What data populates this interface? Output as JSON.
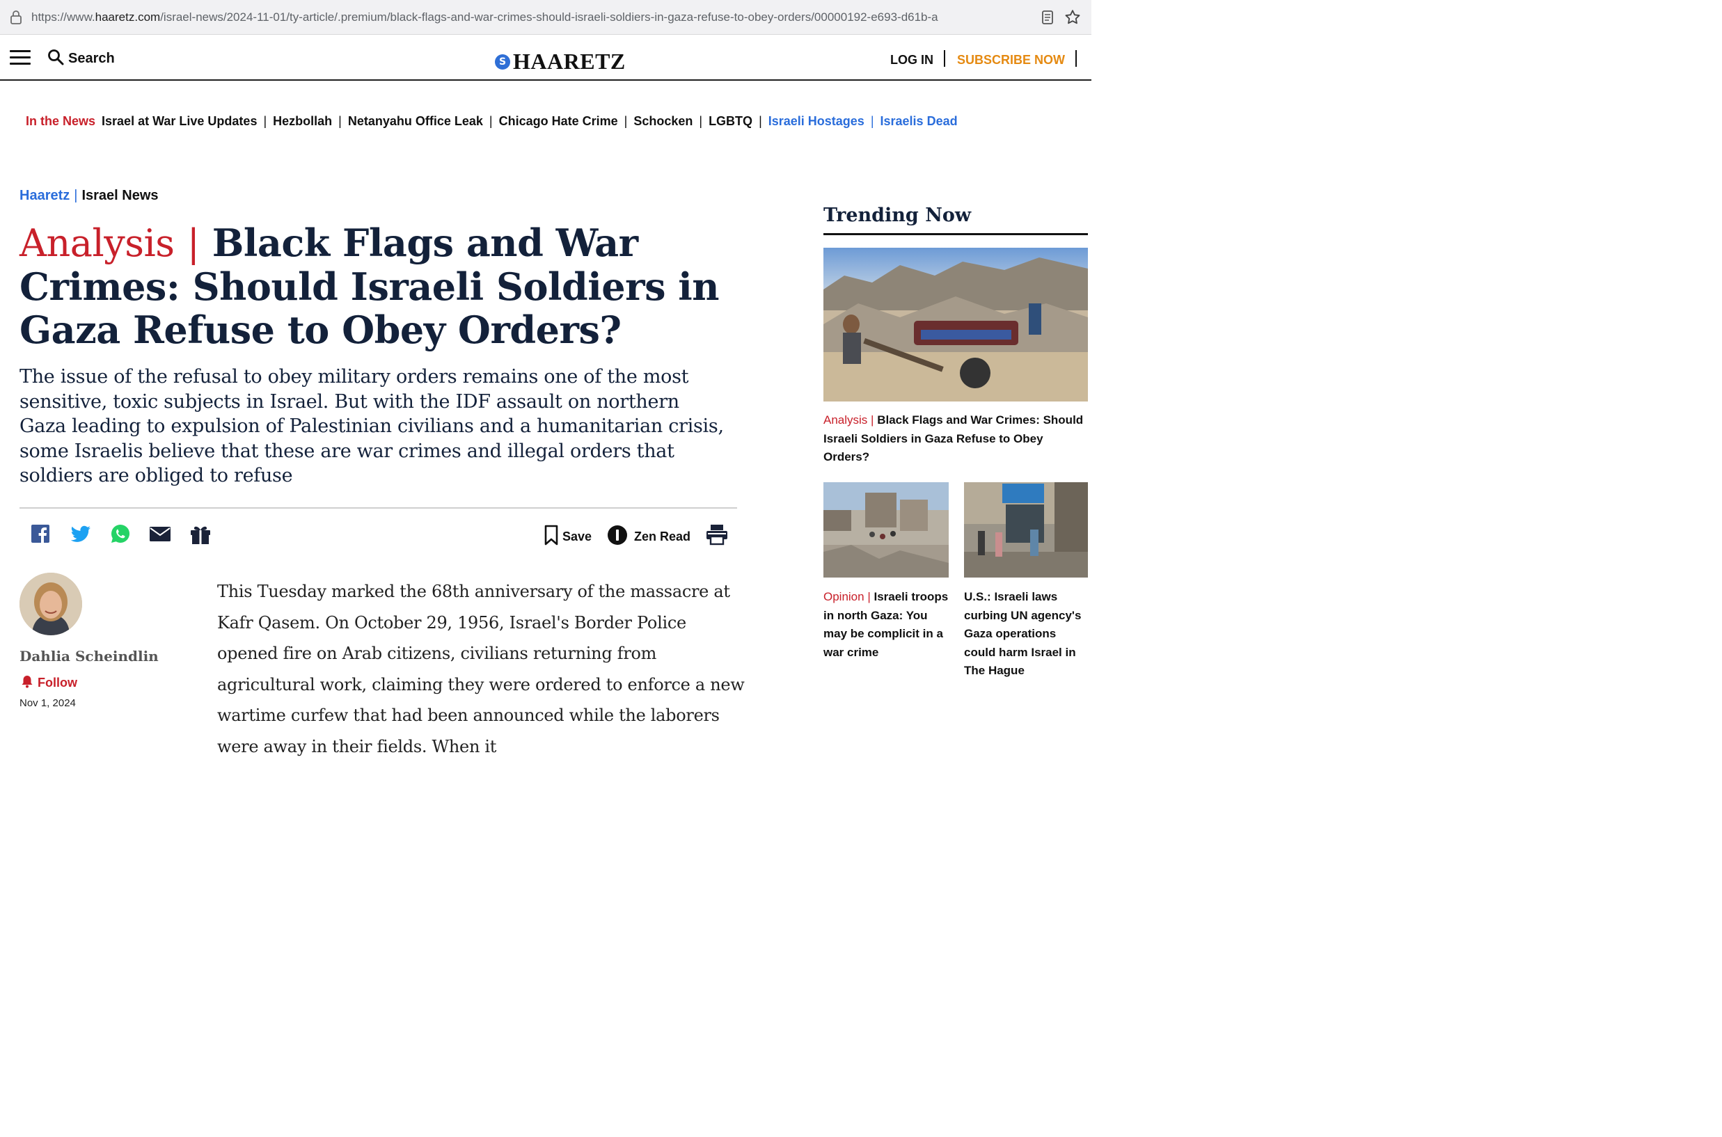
{
  "browser": {
    "url_prefix": "https://www.",
    "url_domain": "haaretz.com",
    "url_rest": "/israel-news/2024-11-01/ty-article/.premium/black-flags-and-war-crimes-should-israeli-soldiers-in-gaza-refuse-to-obey-orders/00000192-e693-d61b-a"
  },
  "header": {
    "search_label": "Search",
    "logo_text": "HAARETZ",
    "logo_mark": "S",
    "login_label": "LOG IN",
    "subscribe_label": "SUBSCRIBE NOW",
    "subscribe_color": "#e58a12"
  },
  "in_the_news": {
    "lead": "In the News",
    "items": [
      "Israel at War Live Updates",
      "Hezbollah",
      "Netanyahu Office Leak",
      "Chicago Hate Crime",
      "Schocken",
      "LGBTQ",
      "Israeli Hostages",
      "Israelis Dead"
    ]
  },
  "breadcrumb": {
    "section": "Haaretz",
    "subsection": "Israel News"
  },
  "article": {
    "kicker": "Analysis",
    "kicker_color": "#c8202a",
    "title": "Black Flags and War Crimes: Should Israeli Soldiers in Gaza Refuse to Obey Orders?",
    "subtitle": "The issue of the refusal to obey military orders remains one of the most sensitive, toxic subjects in Israel. But with the IDF assault on northern Gaza leading to expulsion of Palestinian civilians and a humanitarian crisis, some Israelis believe that these are war crimes and illegal orders that soldiers are obliged to refuse",
    "author": "Dahlia Scheindlin",
    "follow_label": "Follow",
    "date": "Nov 1, 2024",
    "body": "This Tuesday marked the 68th anniversary of the massacre at Kafr Qasem. On October 29, 1956, Israel's Border Police opened fire on Arab citizens, civilians returning from agricultural work, claiming they were ordered to enforce a new wartime curfew that had been announced while the laborers were away in their fields. When it"
  },
  "toolbar": {
    "share_icons": [
      "facebook-icon",
      "twitter-icon",
      "whatsapp-icon",
      "email-icon",
      "gift-icon"
    ],
    "save_label": "Save",
    "zen_label": "Zen Read"
  },
  "sidebar": {
    "heading": "Trending Now",
    "main_story": {
      "kicker": "Analysis",
      "title": "Black Flags and War Crimes: Should Israeli Soldiers in Gaza Refuse to Obey Orders?"
    },
    "story_two": {
      "kicker": "Opinion",
      "title": "Israeli troops in north Gaza: You may be complicit in a war crime"
    },
    "story_three": {
      "kicker": "",
      "title": "U.S.: Israeli laws curbing UN agency's Gaza operations could harm Israel in The Hague"
    }
  }
}
